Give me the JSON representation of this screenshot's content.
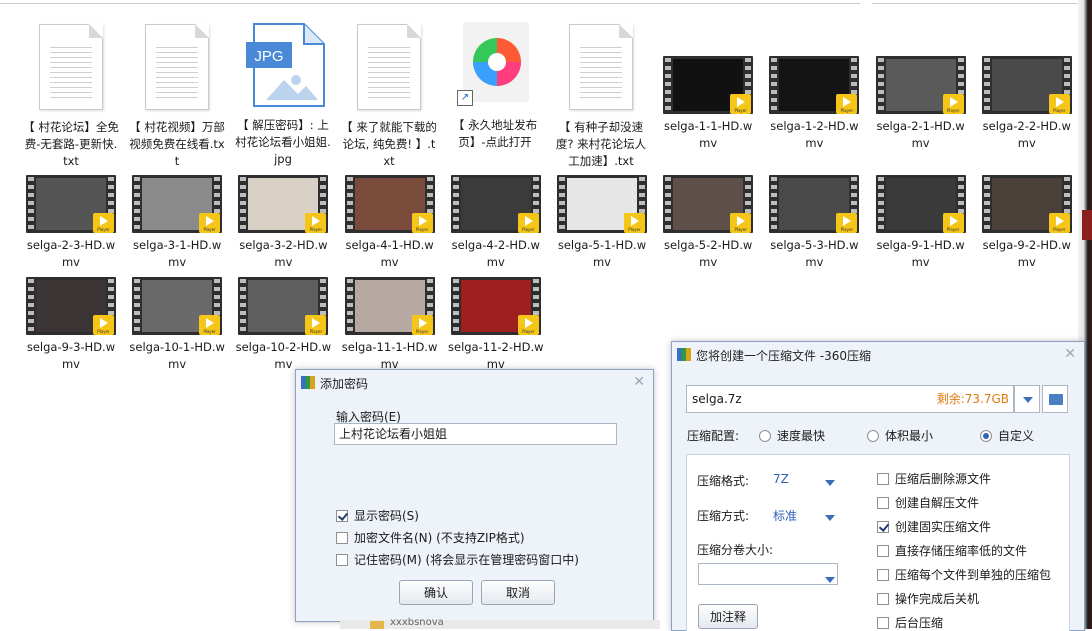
{
  "files": [
    {
      "name": "【 村花论坛】全免费-无套路-更新快.txt",
      "type": "txt"
    },
    {
      "name": "【 村花视频】万部视频免费在线看.txt",
      "type": "txt"
    },
    {
      "name": "【 解压密码】: 上村花论坛看小姐姐.jpg",
      "type": "jpg"
    },
    {
      "name": "【 来了就能下载的论坛, 纯免费! 】.txt",
      "type": "txt"
    },
    {
      "name": "【 永久地址发布页】-点此打开",
      "type": "shortcut"
    },
    {
      "name": "【 有种子却没速度? 来村花论坛人工加速】.txt",
      "type": "txt"
    },
    {
      "name": "selga-1-1-HD.wmv",
      "type": "video"
    },
    {
      "name": "selga-1-2-HD.wmv",
      "type": "video"
    },
    {
      "name": "selga-2-1-HD.wmv",
      "type": "video"
    },
    {
      "name": "selga-2-2-HD.wmv",
      "type": "video"
    },
    {
      "name": "selga-2-3-HD.wmv",
      "type": "video"
    },
    {
      "name": "selga-3-1-HD.wmv",
      "type": "video"
    },
    {
      "name": "selga-3-2-HD.wmv",
      "type": "video"
    },
    {
      "name": "selga-4-1-HD.wmv",
      "type": "video"
    },
    {
      "name": "selga-4-2-HD.wmv",
      "type": "video"
    },
    {
      "name": "selga-5-1-HD.wmv",
      "type": "video"
    },
    {
      "name": "selga-5-2-HD.wmv",
      "type": "video"
    },
    {
      "name": "selga-5-3-HD.wmv",
      "type": "video"
    },
    {
      "name": "selga-9-1-HD.wmv",
      "type": "video"
    },
    {
      "name": "selga-9-2-HD.wmv",
      "type": "video"
    },
    {
      "name": "selga-9-3-HD.wmv",
      "type": "video"
    },
    {
      "name": "selga-10-1-HD.wmv",
      "type": "video"
    },
    {
      "name": "selga-10-2-HD.wmv",
      "type": "video"
    },
    {
      "name": "selga-11-1-HD.wmv",
      "type": "video"
    },
    {
      "name": "selga-11-2-HD.wmv",
      "type": "video"
    }
  ],
  "icons": {
    "jpg_badge": "JPG",
    "player_badge": "Player",
    "shortcut_arrow": "↗",
    "close_glyph": "✕"
  },
  "password_dialog": {
    "title": "添加密码",
    "input_label": "输入密码(E)",
    "password_value": "上村花论坛看小姐姐",
    "options": [
      {
        "label": "显示密码(S)",
        "checked": true
      },
      {
        "label": "加密文件名(N) (不支持ZIP格式)",
        "checked": false
      },
      {
        "label": "记住密码(M) (将会显示在管理密码窗口中)",
        "checked": false
      }
    ],
    "ok_label": "确认",
    "cancel_label": "取消"
  },
  "compress_dialog": {
    "title": "您将创建一个压缩文件 -360压缩",
    "output_file": "selga.7z",
    "free_space": "剩余:73.7GB",
    "config_label": "压缩配置:",
    "config_options": [
      {
        "label": "速度最快",
        "selected": false
      },
      {
        "label": "体积最小",
        "selected": false
      },
      {
        "label": "自定义",
        "selected": true
      }
    ],
    "format_label": "压缩格式:",
    "format_value": "7Z",
    "method_label": "压缩方式:",
    "method_value": "标准",
    "split_label": "压缩分卷大小:",
    "split_value": "",
    "comment_button": "加注释",
    "options": [
      {
        "label": "压缩后删除源文件",
        "checked": false
      },
      {
        "label": "创建自解压文件",
        "checked": false
      },
      {
        "label": "创建固实压缩文件",
        "checked": true
      },
      {
        "label": "直接存储压缩率低的文件",
        "checked": false
      },
      {
        "label": "压缩每个文件到单独的压缩包",
        "checked": false
      },
      {
        "label": "操作完成后关机",
        "checked": false
      },
      {
        "label": "后台压缩",
        "checked": false
      }
    ]
  },
  "taskbar_hint": "xxxbsnova"
}
